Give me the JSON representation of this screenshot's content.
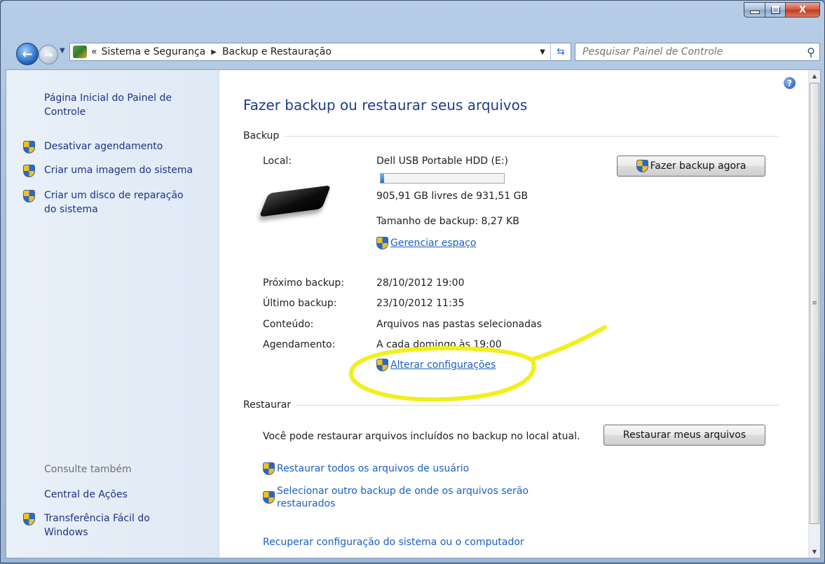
{
  "window": {
    "minimize_label": "–",
    "close_label": "X"
  },
  "address": {
    "prefix": "«",
    "crumbs": [
      "Sistema e Segurança",
      "Backup e Restauração"
    ]
  },
  "search": {
    "placeholder": "Pesquisar Painel de Controle"
  },
  "sidebar": {
    "home": "Página Inicial do Painel de Controle",
    "items": [
      {
        "label": "Desativar agendamento"
      },
      {
        "label": "Criar uma imagem do sistema"
      },
      {
        "label": "Criar um disco de reparação do sistema"
      }
    ],
    "see_also_title": "Consulte também",
    "see_also": [
      {
        "label": "Central de Ações"
      },
      {
        "label": "Transferência Fácil do Windows"
      }
    ]
  },
  "main": {
    "title": "Fazer backup ou restaurar seus arquivos",
    "backup": {
      "section": "Backup",
      "local_label": "Local:",
      "drive_name": "Dell USB Portable HDD (E:)",
      "usage_fraction": 0.028,
      "free_text": "905,91 GB livres de 931,51 GB",
      "backup_size": "Tamanho de backup: 8,27 KB",
      "manage_space": "Gerenciar espaço",
      "backup_now": "Fazer backup agora",
      "rows": [
        {
          "label": "Próximo backup:",
          "value": "28/10/2012 19:00"
        },
        {
          "label": "Último backup:",
          "value": "23/10/2012 11:35"
        },
        {
          "label": "Conteúdo:",
          "value": "Arquivos nas pastas selecionadas"
        },
        {
          "label": "Agendamento:",
          "value": "A cada domingo às 19:00"
        }
      ],
      "change_settings": "Alterar configurações"
    },
    "restore": {
      "section": "Restaurar",
      "description": "Você pode restaurar arquivos incluídos no backup no local atual.",
      "restore_button": "Restaurar meus arquivos",
      "restore_all_users": "Restaurar todos os arquivos de usuário",
      "select_other": "Selecionar outro backup de onde os arquivos serão restaurados",
      "recover_system": "Recuperar configuração do sistema ou o computador"
    }
  },
  "colors": {
    "link": "#1a5fc6",
    "title": "#1e3c8c",
    "annotation": "#f2ef1a"
  }
}
